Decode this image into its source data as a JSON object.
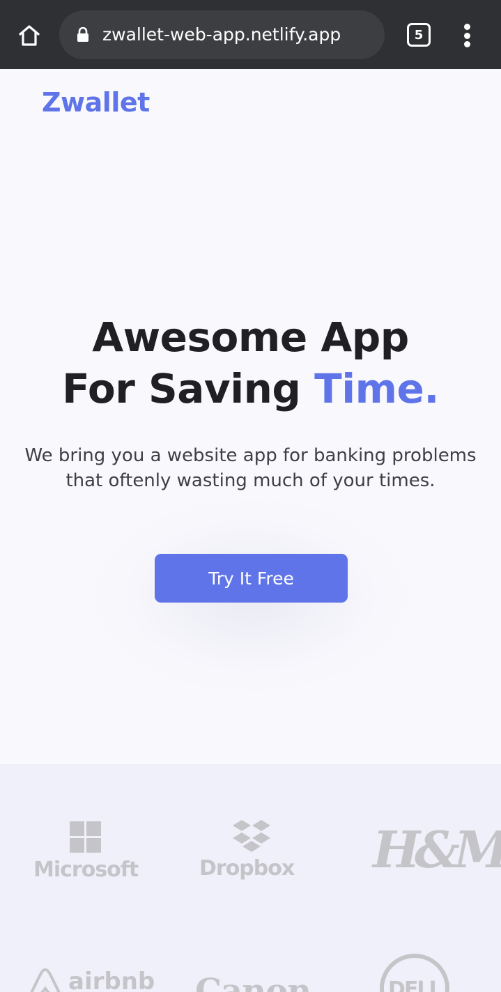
{
  "browser": {
    "url": "zwallet-web-app.netlify.app",
    "tab_count": "5",
    "icons": [
      "home-icon",
      "lock-icon",
      "tabs-icon",
      "more-vertical-icon"
    ]
  },
  "header": {
    "brand": "Zwallet"
  },
  "hero": {
    "title_line1": "Awesome App",
    "title_line2_prefix": "For Saving ",
    "title_line2_accent": "Time.",
    "subtitle_line1": "We bring you a website app for banking problems",
    "subtitle_line2": "that oftenly wasting much of your times.",
    "cta_label": "Try It Free"
  },
  "partners": {
    "logos": [
      "Microsoft",
      "Dropbox",
      "H&M",
      "airbnb",
      "Canon",
      "DELL"
    ]
  },
  "colors": {
    "accent": "#5f74e8",
    "browser_bar": "#2f3033",
    "page_bg": "#f9f9fd",
    "partners_bg": "#f0f0fa",
    "logo_gray": "#c5c5c9"
  }
}
